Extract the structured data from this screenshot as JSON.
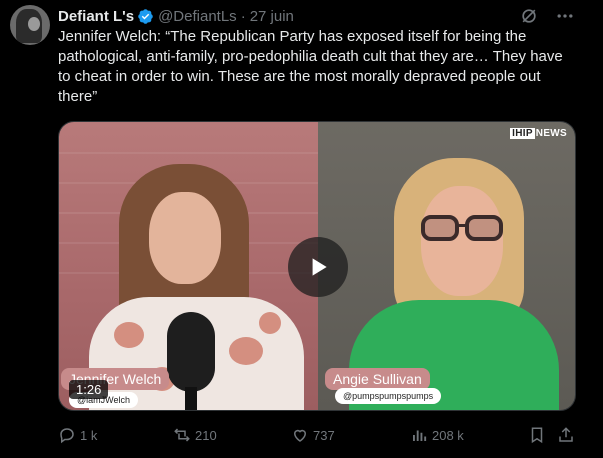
{
  "author": {
    "name": "Defiant L's",
    "handle": "@DefiantLs",
    "separator": "·",
    "date": "27 juin",
    "verified": true
  },
  "tweet": {
    "text": "Jennifer Welch: “The Republican Party has exposed itself for being the pathological, anti-family, pro-pedophilia death cult that they are… They have to cheat in order to win. These are the most morally depraved people out there”"
  },
  "header_icons": [
    "grok-icon",
    "more-icon"
  ],
  "video": {
    "brand_box": "IHIP",
    "brand_text": "NEWS",
    "duration": "1:26",
    "left_name": "Jennifer Welch",
    "left_handle": "@iamJWelch",
    "right_name": "Angie Sullivan",
    "right_handle": "@pumpspumpspumps"
  },
  "actions": {
    "replies": "1 k",
    "reposts": "210",
    "likes": "737",
    "views": "208 k"
  },
  "colors": {
    "background": "#000000",
    "text": "#e7e9ea",
    "muted": "#71767b",
    "verified": "#1d9bf0"
  }
}
